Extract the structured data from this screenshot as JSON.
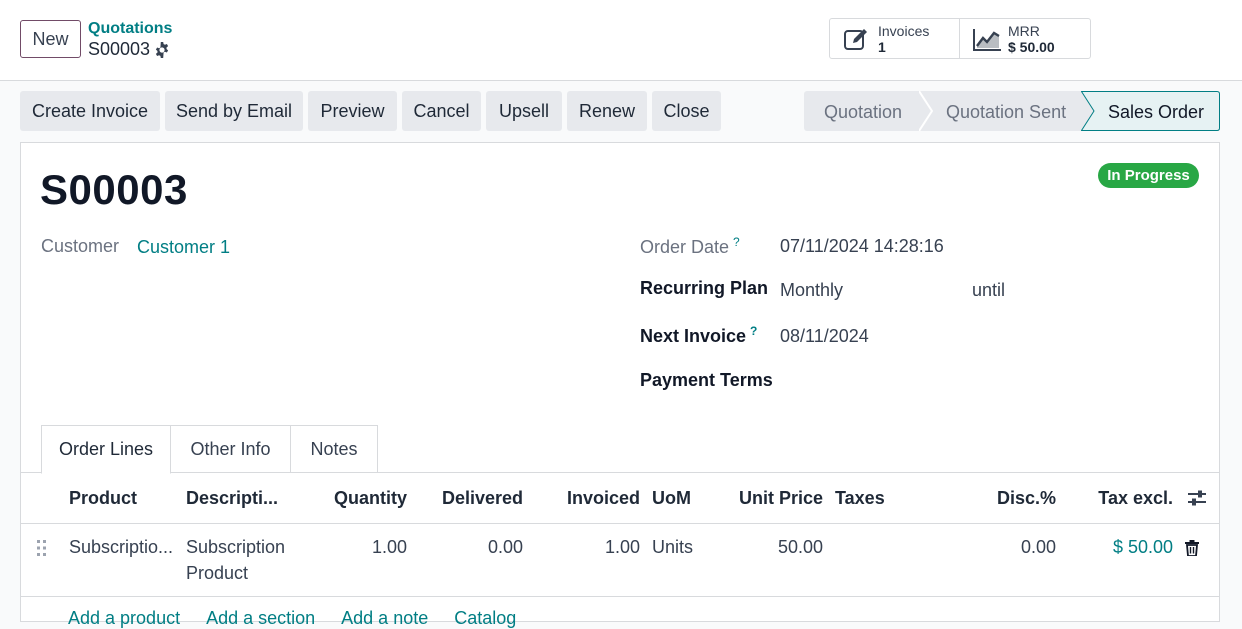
{
  "control_panel": {
    "new_label": "New",
    "breadcrumb_parent": "Quotations",
    "breadcrumb_current": "S00003",
    "smart_buttons": {
      "invoices": {
        "label": "Invoices",
        "value": "1"
      },
      "mrr": {
        "label": "MRR",
        "value": "$ 50.00"
      }
    }
  },
  "actions": [
    "Create Invoice",
    "Send by Email",
    "Preview",
    "Cancel",
    "Upsell",
    "Renew",
    "Close"
  ],
  "statusbar": {
    "stages": [
      "Quotation",
      "Quotation Sent",
      "Sales Order"
    ],
    "active": "Sales Order"
  },
  "form": {
    "ribbon": "In Progress",
    "name": "S00003",
    "customer_label": "Customer",
    "customer_value": "Customer 1",
    "order_date_label": "Order Date",
    "order_date_value": "07/11/2024 14:28:16",
    "recurring_plan_label": "Recurring Plan",
    "recurring_plan_value": "Monthly",
    "until_label": "until",
    "next_invoice_label": "Next Invoice",
    "next_invoice_value": "08/11/2024",
    "payment_terms_label": "Payment Terms",
    "help_mark": "?"
  },
  "tabs": [
    "Order Lines",
    "Other Info",
    "Notes"
  ],
  "order_lines": {
    "columns": [
      "Product",
      "Descripti...",
      "Quantity",
      "Delivered",
      "Invoiced",
      "UoM",
      "Unit Price",
      "Taxes",
      "Disc.%",
      "Tax excl."
    ],
    "rows": [
      {
        "product": "Subscriptio...",
        "description_1": "Subscription",
        "description_2": "Product",
        "quantity": "1.00",
        "delivered": "0.00",
        "invoiced": "1.00",
        "uom": "Units",
        "unit_price": "50.00",
        "taxes": "",
        "discount": "0.00",
        "subtotal": "$ 50.00"
      }
    ],
    "footer_links": [
      "Add a product",
      "Add a section",
      "Add a note",
      "Catalog"
    ]
  },
  "colors": {
    "primary": "#714b67",
    "link": "#017e84",
    "ribbon": "#28a745",
    "button_bg": "#e7e9ed"
  }
}
